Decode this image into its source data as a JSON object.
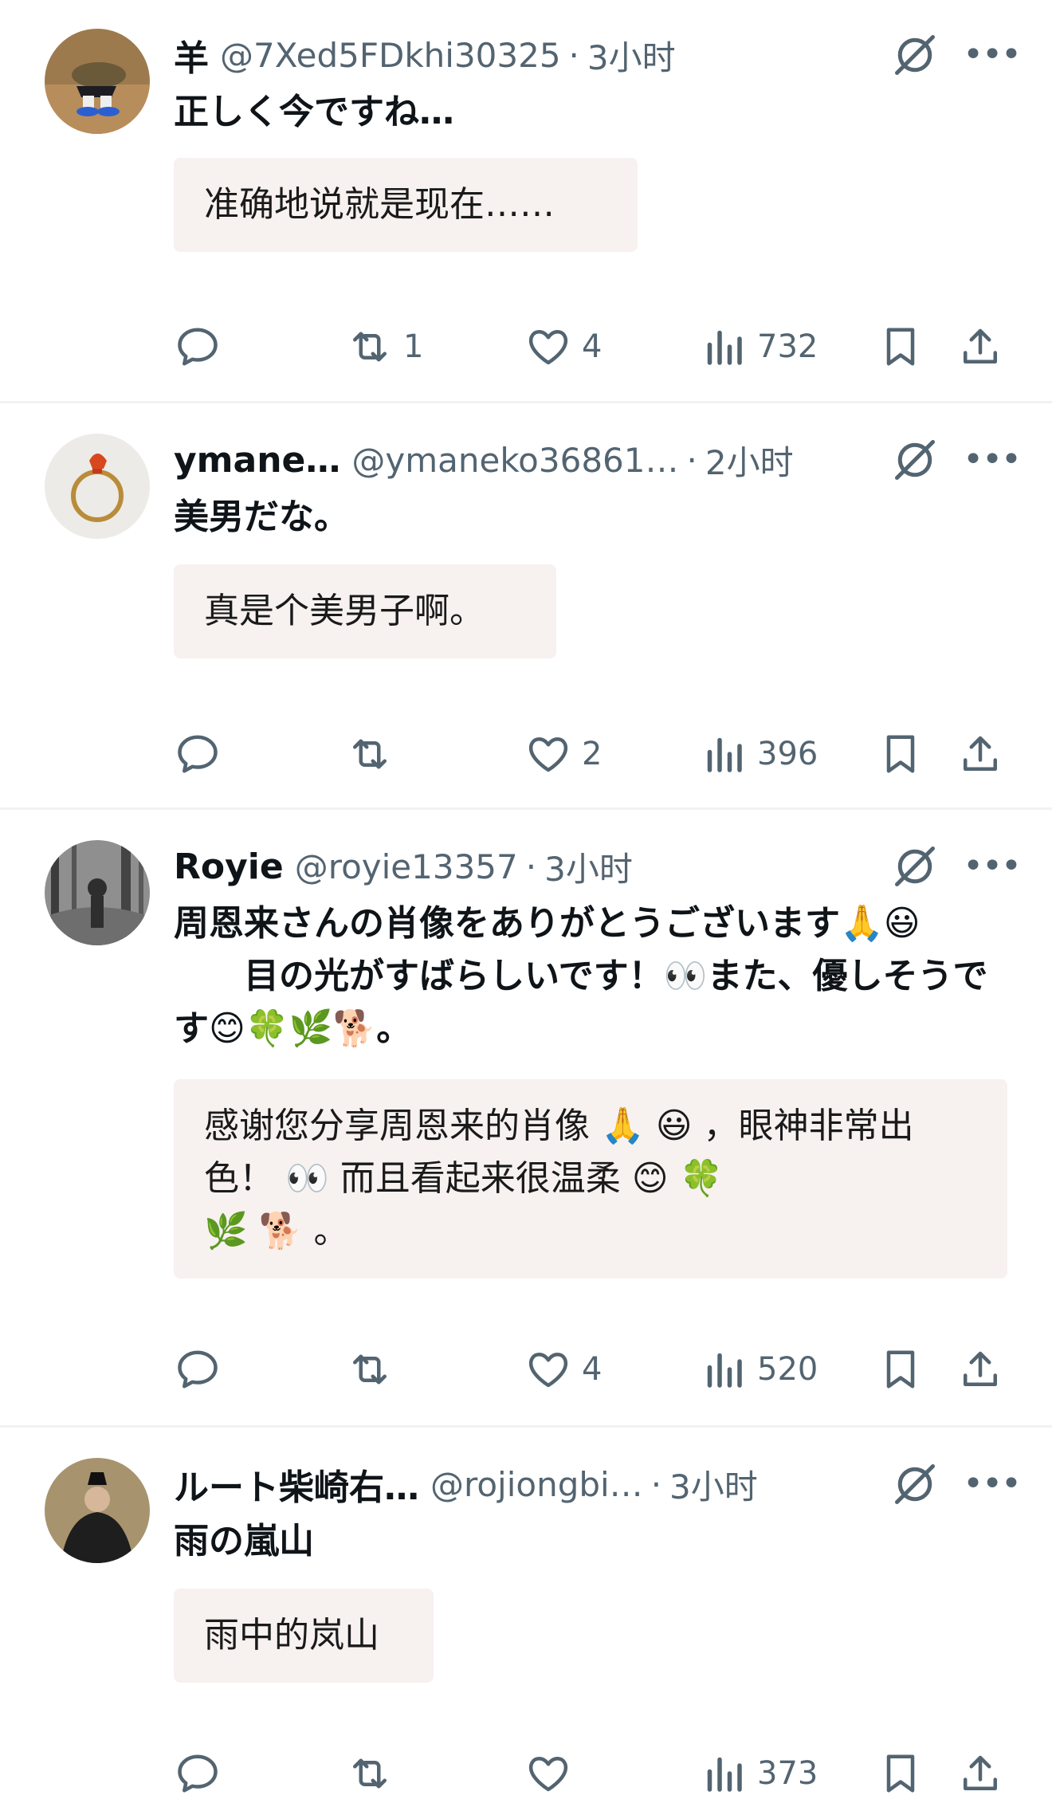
{
  "replies": [
    {
      "name": "羊",
      "handle": "@7Xed5FDkhi30325",
      "separator": "·",
      "time": "3小时",
      "text": "正しく今ですね…",
      "translation": "准确地说就是现在……",
      "stats": {
        "reply": "",
        "retweet": "1",
        "like": "4",
        "views": "732"
      }
    },
    {
      "name": "ymane…",
      "handle": "@ymaneko36861…",
      "separator": "·",
      "time": "2小时",
      "text": "美男だな。",
      "translation": "真是个美男子啊。",
      "stats": {
        "reply": "",
        "retweet": "",
        "like": "2",
        "views": "396"
      }
    },
    {
      "name": "Royie",
      "handle": "@royie13357",
      "separator": "·",
      "time": "3小时",
      "text": "周恩来さんの肖像をありがとうございます🙏😃\n　　目の光がすばらしいです！👀また、優しそうです😊🍀🌿🐕。",
      "translation": "感谢您分享周恩来的肖像 🙏 😃 ，眼神非常出色！ 👀 而且看起来很温柔 😊 🍀\n🌿 🐕 。",
      "stats": {
        "reply": "",
        "retweet": "",
        "like": "4",
        "views": "520"
      }
    },
    {
      "name": "ルート柴崎右…",
      "handle": "@rojiongbi…",
      "separator": "·",
      "time": "3小时",
      "text": "雨の嵐山",
      "translation": "雨中的岚山",
      "stats": {
        "reply": "",
        "retweet": "",
        "like": "",
        "views": "373"
      }
    }
  ],
  "icons": {
    "reply": "reply-icon",
    "retweet": "retweet-icon",
    "like": "heart-icon",
    "views": "views-icon",
    "bookmark": "bookmark-icon",
    "share": "share-icon",
    "grok": "grok-icon",
    "more": "more-icon"
  },
  "colors": {
    "muted": "#536471",
    "translation_bg": "#f7f1f0",
    "divider": "#eff3f4"
  }
}
